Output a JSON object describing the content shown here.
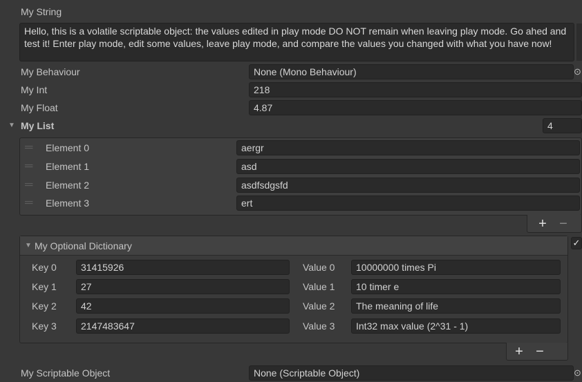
{
  "my_string": {
    "label": "My String",
    "value": "Hello, this is a volatile scriptable object: the values edited in play mode DO NOT remain when leaving play mode. Go ahed and test it! Enter play mode, edit some values, leave play mode, and compare the values you changed with what you have now!"
  },
  "my_behaviour": {
    "label": "My Behaviour",
    "value": "None (Mono Behaviour)"
  },
  "my_int": {
    "label": "My Int",
    "value": "218"
  },
  "my_float": {
    "label": "My Float",
    "value": "4.87"
  },
  "my_list": {
    "label": "My List",
    "size": "4",
    "elements": [
      {
        "label": "Element 0",
        "value": "aergr"
      },
      {
        "label": "Element 1",
        "value": "asd"
      },
      {
        "label": "Element 2",
        "value": "asdfsdgsfd"
      },
      {
        "label": "Element 3",
        "value": "ert"
      }
    ],
    "add_label": "+",
    "remove_label": "−"
  },
  "my_dictionary": {
    "label": "My Optional Dictionary",
    "entries": [
      {
        "key_label": "Key 0",
        "key": "31415926",
        "value_label": "Value 0",
        "value": "10000000 times Pi"
      },
      {
        "key_label": "Key 1",
        "key": "27",
        "value_label": "Value 1",
        "value": "10 timer e"
      },
      {
        "key_label": "Key 2",
        "key": "42",
        "value_label": "Value 2",
        "value": "The meaning of life"
      },
      {
        "key_label": "Key 3",
        "key": "2147483647",
        "value_label": "Value 3",
        "value": "Int32 max value (2^31 - 1)"
      }
    ],
    "add_label": "+",
    "remove_label": "−",
    "enabled_check": "✓"
  },
  "my_scriptable_object": {
    "label": "My Scriptable Object",
    "value": "None (Scriptable Object)"
  },
  "icons": {
    "object_picker": "⊙",
    "foldout_open": "▼",
    "drag_handle": "═"
  }
}
